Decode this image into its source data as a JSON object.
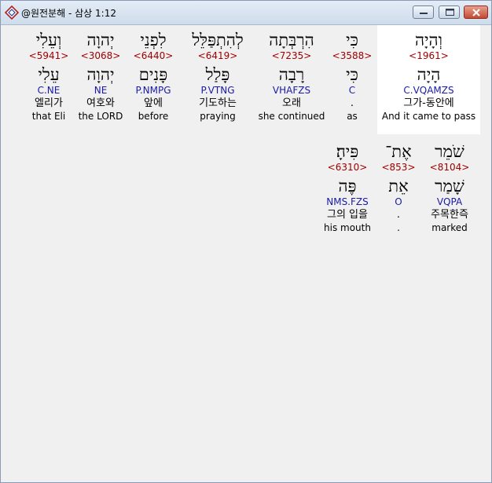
{
  "window": {
    "title": "@원전분해 - 삼상 1:12",
    "icon": "app-diamond-icon"
  },
  "colors": {
    "strong": "#a00000",
    "parse": "#1a1aa8",
    "highlight_bg": "#ffffff"
  },
  "words": [
    {
      "hebrew": "וְהָיָה",
      "strong": "<1961>",
      "lemma": "הָיָה",
      "parse": "C.VQAMZS",
      "korean": "그가-동안에",
      "english": "And it came to pass"
    },
    {
      "hebrew": "כִּי",
      "strong": "<3588>",
      "lemma": "כִּי",
      "parse": "C",
      "korean": ".",
      "english": "as"
    },
    {
      "hebrew": "הִרְבְּתָה",
      "strong": "<7235>",
      "lemma": "רָבָה",
      "parse": "VHAFZS",
      "korean": "오래",
      "english": "she continued"
    },
    {
      "hebrew": "לְהִתְפַּלֵּל",
      "strong": "<6419>",
      "lemma": "פָּלַל",
      "parse": "P.VTNG",
      "korean": "기도하는",
      "english": "praying"
    },
    {
      "hebrew": "לִפְנֵי",
      "strong": "<6440>",
      "lemma": "פָּנִים",
      "parse": "P.NMPG",
      "korean": "앞에",
      "english": "before"
    },
    {
      "hebrew": "יְהוָה",
      "strong": "<3068>",
      "lemma": "יְהוָה",
      "parse": "NE",
      "korean": "여호와",
      "english": "the LORD"
    },
    {
      "hebrew": "וְעֵלִי",
      "strong": "<5941>",
      "lemma": "עֵלִי",
      "parse": "C.NE",
      "korean": "엘리가",
      "english": "that Eli"
    },
    {
      "hebrew": "שֹׁמֵר",
      "strong": "<8104>",
      "lemma": "שָׁמַר",
      "parse": "VQPA",
      "korean": "주목한즉",
      "english": "marked"
    },
    {
      "hebrew": "אֶת־",
      "strong": "<853>",
      "lemma": "אֵת",
      "parse": "O",
      "korean": ".",
      "english": "."
    },
    {
      "hebrew": "פִּיהָ׃",
      "strong": "<6310>",
      "lemma": "פֶּה",
      "parse": "NMS.FZS",
      "korean": "그의 입을",
      "english": "his mouth"
    }
  ]
}
